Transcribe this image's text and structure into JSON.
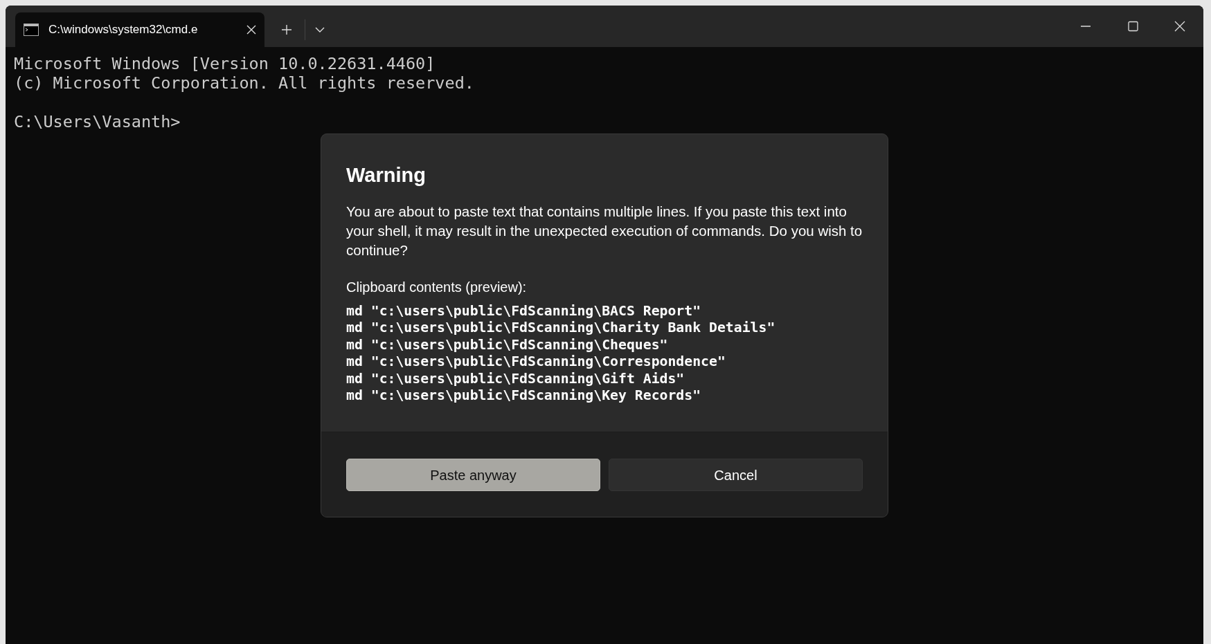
{
  "window": {
    "tabs": [
      {
        "title": "C:\\windows\\system32\\cmd.e",
        "selected": true
      }
    ]
  },
  "terminal": {
    "lines": [
      "Microsoft Windows [Version 10.0.22631.4460]",
      "(c) Microsoft Corporation. All rights reserved."
    ],
    "prompt": "C:\\Users\\Vasanth>"
  },
  "dialog": {
    "title": "Warning",
    "message": "You are about to paste text that contains multiple lines. If you paste this text into your shell, it may result in the unexpected execution of commands. Do you wish to continue?",
    "preview_label": "Clipboard contents (preview):",
    "preview_lines": [
      "md \"c:\\users\\public\\FdScanning\\BACS Report\"",
      "md \"c:\\users\\public\\FdScanning\\Charity Bank Details\"",
      "md \"c:\\users\\public\\FdScanning\\Cheques\"",
      "md \"c:\\users\\public\\FdScanning\\Correspondence\"",
      "md \"c:\\users\\public\\FdScanning\\Gift Aids\"",
      "md \"c:\\users\\public\\FdScanning\\Key Records\""
    ],
    "buttons": [
      {
        "label": "Paste anyway",
        "kind": "primary"
      },
      {
        "label": "Cancel",
        "kind": "secondary"
      }
    ]
  }
}
